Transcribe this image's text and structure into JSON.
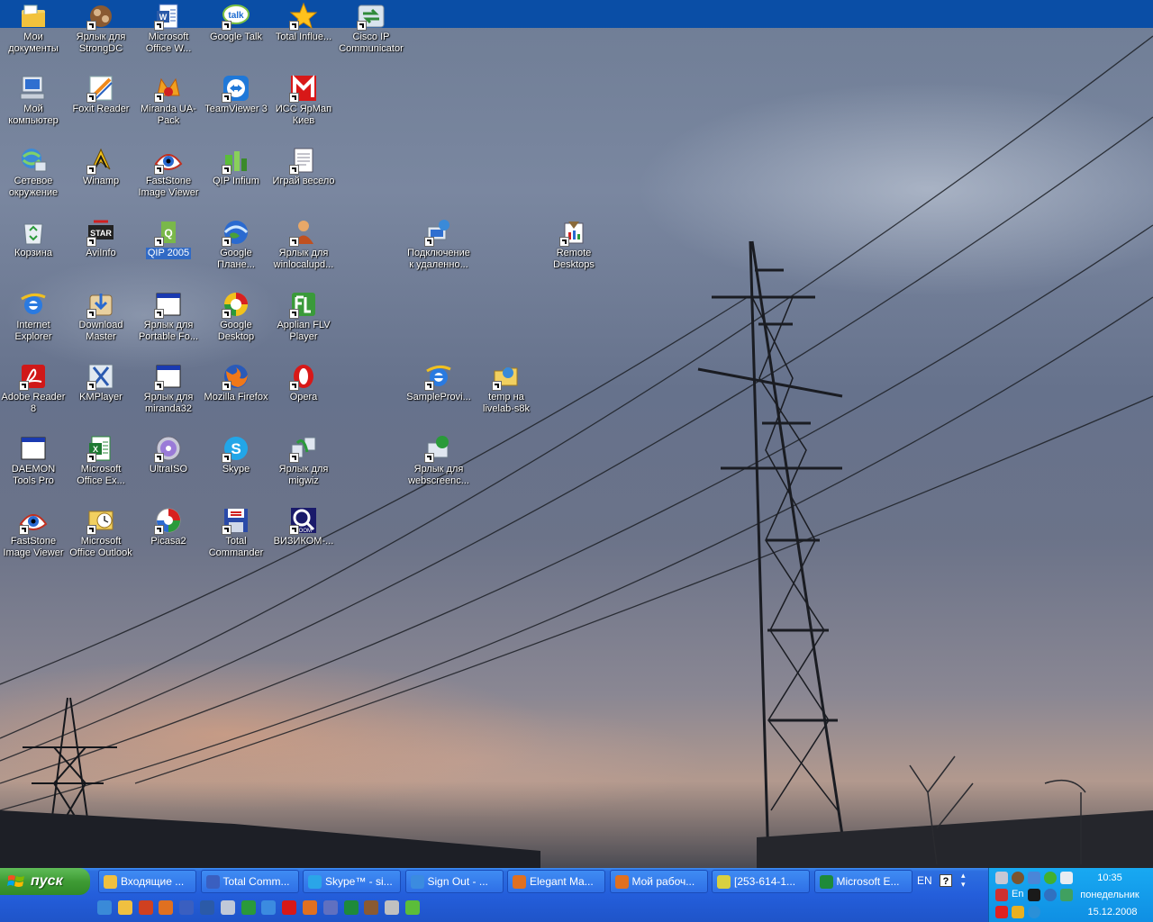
{
  "desktop": {
    "icons": [
      {
        "label": "Мои документы",
        "icon": "my-documents-icon"
      },
      {
        "label": "Ярлык для StrongDC",
        "icon": "strongdc-icon"
      },
      {
        "label": "Microsoft Office W...",
        "icon": "word-icon"
      },
      {
        "label": "Google Talk",
        "icon": "google-talk-icon"
      },
      {
        "label": "Total Influe...",
        "icon": "star-icon"
      },
      {
        "label": "Cisco IP Communicator",
        "icon": "cisco-icon"
      },
      {
        "label": "Мой компьютер",
        "icon": "my-computer-icon"
      },
      {
        "label": "Foxit Reader",
        "icon": "foxit-icon"
      },
      {
        "label": "Miranda UA-Pack",
        "icon": "miranda-icon"
      },
      {
        "label": "TeamViewer 3",
        "icon": "teamviewer-icon"
      },
      {
        "label": "ИСС ЯрМап Киев",
        "icon": "yarmap-icon"
      },
      {
        "label": "Сетевое окружение",
        "icon": "network-icon"
      },
      {
        "label": "Winamp",
        "icon": "winamp-icon"
      },
      {
        "label": "FastStone Image Viewer",
        "icon": "faststone-icon"
      },
      {
        "label": "QIP Infium",
        "icon": "qip-infium-icon"
      },
      {
        "label": "Играй весело",
        "icon": "document-icon"
      },
      {
        "label": "Корзина",
        "icon": "recycle-bin-icon"
      },
      {
        "label": "AviInfo",
        "icon": "aviinfo-icon"
      },
      {
        "label": "QIP 2005",
        "icon": "qip-icon"
      },
      {
        "label": "Google Плане...",
        "icon": "google-earth-icon"
      },
      {
        "label": "Ярлык для winlocalupd...",
        "icon": "person-icon"
      },
      {
        "label": "Подключение к удаленно...",
        "icon": "remote-connection-icon"
      },
      {
        "label": "Remote Desktops",
        "icon": "remote-desktops-icon"
      },
      {
        "label": "Internet Explorer",
        "icon": "ie-icon"
      },
      {
        "label": "Download Master",
        "icon": "download-master-icon"
      },
      {
        "label": "Ярлык для Portable Fo...",
        "icon": "window-icon"
      },
      {
        "label": "Google Desktop",
        "icon": "google-desktop-icon"
      },
      {
        "label": "Applian FLV Player",
        "icon": "flv-player-icon"
      },
      {
        "label": "Adobe Reader 8",
        "icon": "adobe-reader-icon"
      },
      {
        "label": "KMPlayer",
        "icon": "kmplayer-icon"
      },
      {
        "label": "Ярлык для miranda32",
        "icon": "window-icon"
      },
      {
        "label": "Mozilla Firefox",
        "icon": "firefox-icon"
      },
      {
        "label": "Opera",
        "icon": "opera-icon"
      },
      {
        "label": "SampleProvi...",
        "icon": "ie-icon"
      },
      {
        "label": "temp на livelab-s8k",
        "icon": "network-folder-icon"
      },
      {
        "label": "DAEMON Tools Pro",
        "icon": "window-icon"
      },
      {
        "label": "Microsoft Office Ex...",
        "icon": "excel-icon"
      },
      {
        "label": "UltraISO",
        "icon": "disc-icon"
      },
      {
        "label": "Skype",
        "icon": "skype-icon"
      },
      {
        "label": "Ярлык для migwiz",
        "icon": "migwiz-icon"
      },
      {
        "label": "Ярлык для webscreenc...",
        "icon": "webscreen-icon"
      },
      {
        "label": "FastStone Image Viewer",
        "icon": "faststone-icon"
      },
      {
        "label": "Microsoft Office Outlook",
        "icon": "outlook-icon"
      },
      {
        "label": "Picasa2",
        "icon": "picasa-icon"
      },
      {
        "label": "Total Commander",
        "icon": "floppy-icon"
      },
      {
        "label": "ВИЗИКОМ-...",
        "icon": "zoom-icon"
      }
    ]
  },
  "taskbar": {
    "start_label": "пуск",
    "buttons": [
      {
        "label": "Входящие ...",
        "icon": "outlook-icon",
        "color": "#f0c040"
      },
      {
        "label": "Total Comm...",
        "icon": "floppy-icon",
        "color": "#3a5fc0"
      },
      {
        "label": "Skype™ - si...",
        "icon": "skype-icon",
        "color": "#2aa5e8"
      },
      {
        "label": "Sign Out - ...",
        "icon": "ie-icon",
        "color": "#3b8be0"
      },
      {
        "label": "Elegant Ma...",
        "icon": "firefox-icon",
        "color": "#e07020"
      },
      {
        "label": "Мой рабоч...",
        "icon": "firefox-icon",
        "color": "#e07020"
      },
      {
        "label": "[253-614-1...",
        "icon": "sheet-icon",
        "color": "#d8d040"
      },
      {
        "label": "Microsoft E...",
        "icon": "excel-icon",
        "color": "#1e8a3a"
      }
    ],
    "language": "EN",
    "tray_lang": "En",
    "clock": {
      "time": "10:35",
      "day": "понедельник",
      "date": "15.12.2008"
    }
  }
}
